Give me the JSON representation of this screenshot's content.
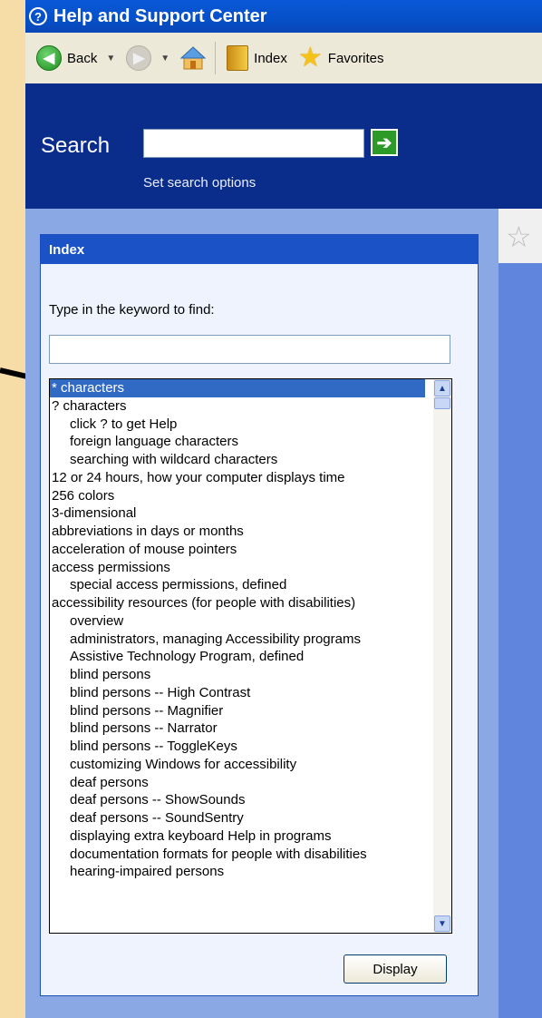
{
  "window": {
    "title": "Help and Support Center"
  },
  "toolbar": {
    "back_label": "Back",
    "index_label": "Index",
    "favorites_label": "Favorites"
  },
  "search": {
    "label": "Search",
    "value": "",
    "options_link": "Set search options"
  },
  "index": {
    "header": "Index",
    "keyword_label": "Type in the keyword to find:",
    "keyword_value": "",
    "items": [
      "* characters",
      "? characters",
      "click ? to get Help",
      "foreign language characters",
      "searching with wildcard characters",
      "12 or 24 hours, how your computer displays time",
      "256 colors",
      "3-dimensional",
      "abbreviations in days or months",
      "acceleration of mouse pointers",
      "access permissions",
      "special access permissions, defined",
      "accessibility resources (for people with disabilities)",
      "overview",
      "administrators, managing Accessibility programs",
      "Assistive Technology Program, defined",
      "blind persons",
      "blind persons -- High Contrast",
      "blind persons -- Magnifier",
      "blind persons -- Narrator",
      "blind persons -- ToggleKeys",
      "customizing Windows for accessibility",
      "deaf persons",
      "deaf persons -- ShowSounds",
      "deaf persons -- SoundSentry",
      "displaying extra keyboard Help in programs",
      "documentation formats for people with disabilities",
      "hearing-impaired persons"
    ],
    "display_button": "Display"
  }
}
